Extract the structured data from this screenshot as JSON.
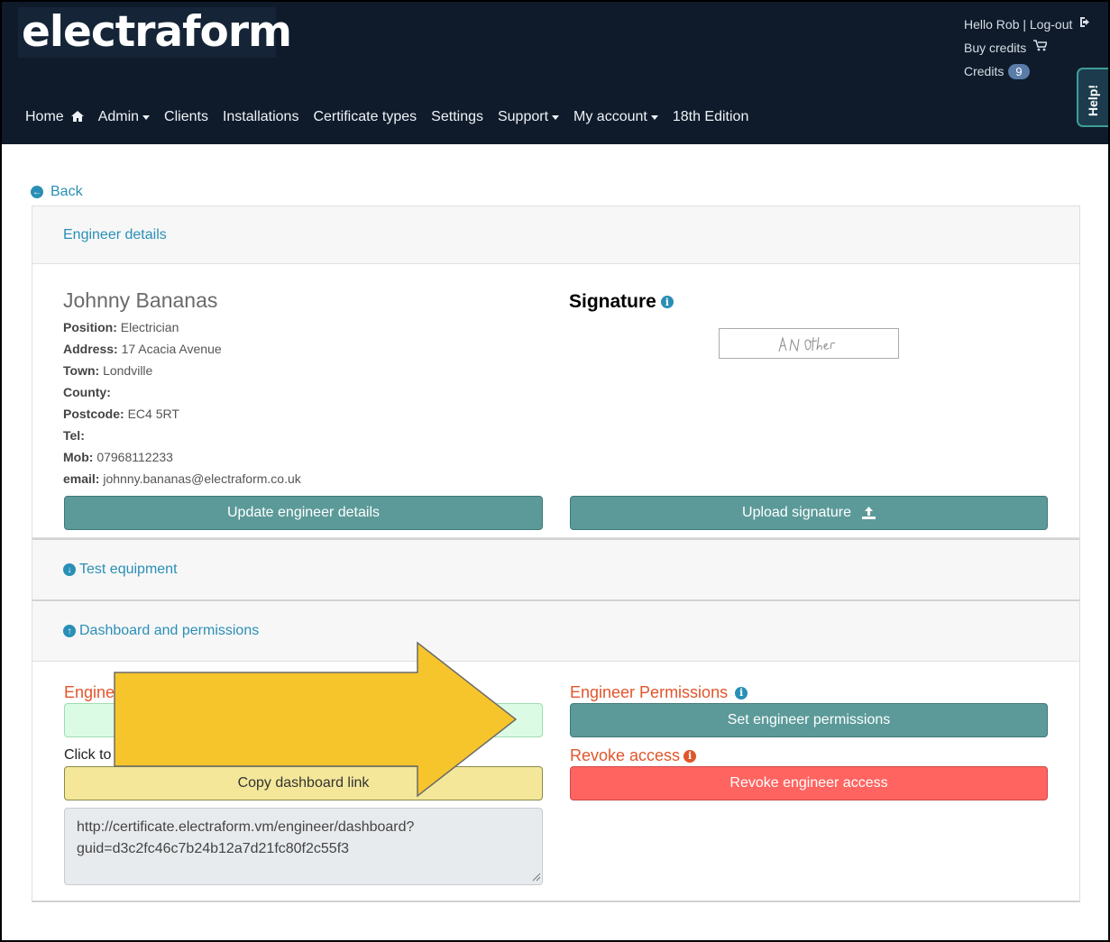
{
  "brand": {
    "logo": "electraform"
  },
  "user": {
    "greeting": "Hello Rob | Log-out",
    "buy_credits": "Buy credits",
    "credits_label": "Credits",
    "credits_count": "9"
  },
  "help_tab": "Help!",
  "nav": [
    {
      "label": "Home",
      "icon": "home-icon"
    },
    {
      "label": "Admin",
      "dropdown": true
    },
    {
      "label": "Clients"
    },
    {
      "label": "Installations"
    },
    {
      "label": "Certificate types"
    },
    {
      "label": "Settings"
    },
    {
      "label": "Support",
      "dropdown": true
    },
    {
      "label": "My account",
      "dropdown": true
    },
    {
      "label": "18th Edition"
    }
  ],
  "back_label": "Back",
  "engineer_details": {
    "header": "Engineer details",
    "name": "Johnny Bananas",
    "fields": [
      {
        "label": "Position:",
        "value": "Electrician"
      },
      {
        "label": "Address:",
        "value": "17 Acacia Avenue"
      },
      {
        "label": "Town:",
        "value": "Londville"
      },
      {
        "label": "County:",
        "value": ""
      },
      {
        "label": "Postcode:",
        "value": "EC4 5RT"
      },
      {
        "label": "Tel:",
        "value": ""
      },
      {
        "label": "Mob:",
        "value": "07968112233"
      },
      {
        "label": "email:",
        "value": "johnny.bananas@electraform.co.uk"
      }
    ],
    "signature_title": "Signature",
    "signature_text": "A N Other",
    "update_button": "Update engineer details",
    "upload_button": "Upload signature"
  },
  "test_equipment": {
    "header": "Test equipment"
  },
  "dashboard": {
    "header": "Dashboard and permissions",
    "engineer_dashboard_title": "Engine",
    "click_to_text": "Click to",
    "copy_button": "Copy dashboard link",
    "dashboard_url": "http://certificate.electraform.vm/engineer/dashboard?guid=d3c2fc46c7b24b12a7d21fc80f2c55f3",
    "permissions_title": "Engineer Permissions",
    "set_permissions_button": "Set engineer permissions",
    "revoke_title": "Revoke access",
    "revoke_button": "Revoke engineer access"
  },
  "colors": {
    "nav_bg": "#0f1b2b",
    "teal_button": "#5b9a99",
    "red_button": "#ff6460",
    "link_blue": "#2a8fb6",
    "heading_orange": "#e0562b",
    "arrow_yellow": "#f6c52b"
  }
}
